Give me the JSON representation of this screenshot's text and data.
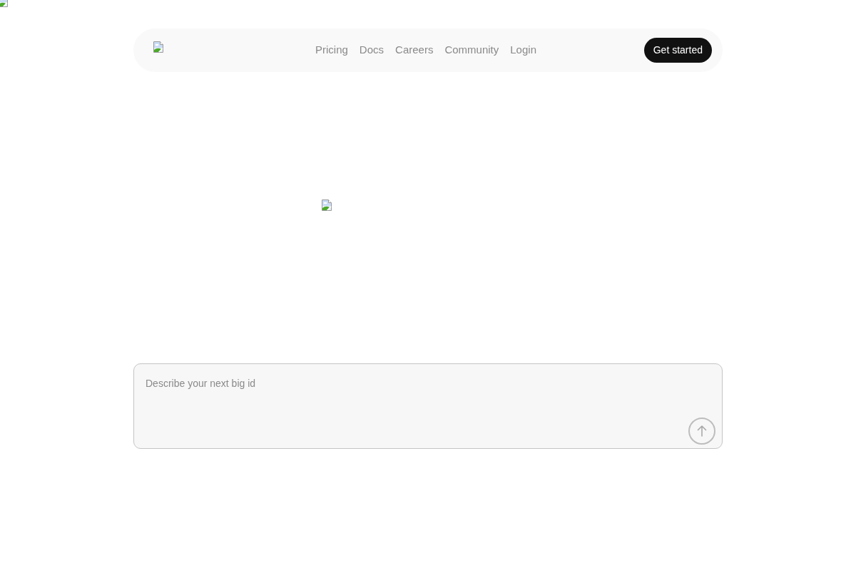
{
  "nav": {
    "links": [
      "Pricing",
      "Docs",
      "Careers",
      "Community",
      "Login"
    ],
    "cta": "Get started"
  },
  "prompt": {
    "placeholder": "Describe your next big id"
  }
}
